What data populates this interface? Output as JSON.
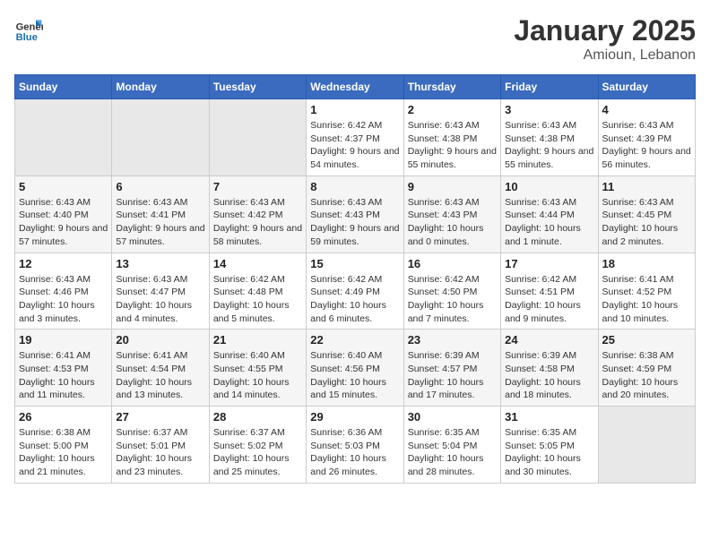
{
  "header": {
    "logo_general": "General",
    "logo_blue": "Blue",
    "month": "January 2025",
    "location": "Amioun, Lebanon"
  },
  "weekdays": [
    "Sunday",
    "Monday",
    "Tuesday",
    "Wednesday",
    "Thursday",
    "Friday",
    "Saturday"
  ],
  "weeks": [
    [
      {
        "day": "",
        "info": ""
      },
      {
        "day": "",
        "info": ""
      },
      {
        "day": "",
        "info": ""
      },
      {
        "day": "1",
        "info": "Sunrise: 6:42 AM\nSunset: 4:37 PM\nDaylight: 9 hours and 54 minutes."
      },
      {
        "day": "2",
        "info": "Sunrise: 6:43 AM\nSunset: 4:38 PM\nDaylight: 9 hours and 55 minutes."
      },
      {
        "day": "3",
        "info": "Sunrise: 6:43 AM\nSunset: 4:38 PM\nDaylight: 9 hours and 55 minutes."
      },
      {
        "day": "4",
        "info": "Sunrise: 6:43 AM\nSunset: 4:39 PM\nDaylight: 9 hours and 56 minutes."
      }
    ],
    [
      {
        "day": "5",
        "info": "Sunrise: 6:43 AM\nSunset: 4:40 PM\nDaylight: 9 hours and 57 minutes."
      },
      {
        "day": "6",
        "info": "Sunrise: 6:43 AM\nSunset: 4:41 PM\nDaylight: 9 hours and 57 minutes."
      },
      {
        "day": "7",
        "info": "Sunrise: 6:43 AM\nSunset: 4:42 PM\nDaylight: 9 hours and 58 minutes."
      },
      {
        "day": "8",
        "info": "Sunrise: 6:43 AM\nSunset: 4:43 PM\nDaylight: 9 hours and 59 minutes."
      },
      {
        "day": "9",
        "info": "Sunrise: 6:43 AM\nSunset: 4:43 PM\nDaylight: 10 hours and 0 minutes."
      },
      {
        "day": "10",
        "info": "Sunrise: 6:43 AM\nSunset: 4:44 PM\nDaylight: 10 hours and 1 minute."
      },
      {
        "day": "11",
        "info": "Sunrise: 6:43 AM\nSunset: 4:45 PM\nDaylight: 10 hours and 2 minutes."
      }
    ],
    [
      {
        "day": "12",
        "info": "Sunrise: 6:43 AM\nSunset: 4:46 PM\nDaylight: 10 hours and 3 minutes."
      },
      {
        "day": "13",
        "info": "Sunrise: 6:43 AM\nSunset: 4:47 PM\nDaylight: 10 hours and 4 minutes."
      },
      {
        "day": "14",
        "info": "Sunrise: 6:42 AM\nSunset: 4:48 PM\nDaylight: 10 hours and 5 minutes."
      },
      {
        "day": "15",
        "info": "Sunrise: 6:42 AM\nSunset: 4:49 PM\nDaylight: 10 hours and 6 minutes."
      },
      {
        "day": "16",
        "info": "Sunrise: 6:42 AM\nSunset: 4:50 PM\nDaylight: 10 hours and 7 minutes."
      },
      {
        "day": "17",
        "info": "Sunrise: 6:42 AM\nSunset: 4:51 PM\nDaylight: 10 hours and 9 minutes."
      },
      {
        "day": "18",
        "info": "Sunrise: 6:41 AM\nSunset: 4:52 PM\nDaylight: 10 hours and 10 minutes."
      }
    ],
    [
      {
        "day": "19",
        "info": "Sunrise: 6:41 AM\nSunset: 4:53 PM\nDaylight: 10 hours and 11 minutes."
      },
      {
        "day": "20",
        "info": "Sunrise: 6:41 AM\nSunset: 4:54 PM\nDaylight: 10 hours and 13 minutes."
      },
      {
        "day": "21",
        "info": "Sunrise: 6:40 AM\nSunset: 4:55 PM\nDaylight: 10 hours and 14 minutes."
      },
      {
        "day": "22",
        "info": "Sunrise: 6:40 AM\nSunset: 4:56 PM\nDaylight: 10 hours and 15 minutes."
      },
      {
        "day": "23",
        "info": "Sunrise: 6:39 AM\nSunset: 4:57 PM\nDaylight: 10 hours and 17 minutes."
      },
      {
        "day": "24",
        "info": "Sunrise: 6:39 AM\nSunset: 4:58 PM\nDaylight: 10 hours and 18 minutes."
      },
      {
        "day": "25",
        "info": "Sunrise: 6:38 AM\nSunset: 4:59 PM\nDaylight: 10 hours and 20 minutes."
      }
    ],
    [
      {
        "day": "26",
        "info": "Sunrise: 6:38 AM\nSunset: 5:00 PM\nDaylight: 10 hours and 21 minutes."
      },
      {
        "day": "27",
        "info": "Sunrise: 6:37 AM\nSunset: 5:01 PM\nDaylight: 10 hours and 23 minutes."
      },
      {
        "day": "28",
        "info": "Sunrise: 6:37 AM\nSunset: 5:02 PM\nDaylight: 10 hours and 25 minutes."
      },
      {
        "day": "29",
        "info": "Sunrise: 6:36 AM\nSunset: 5:03 PM\nDaylight: 10 hours and 26 minutes."
      },
      {
        "day": "30",
        "info": "Sunrise: 6:35 AM\nSunset: 5:04 PM\nDaylight: 10 hours and 28 minutes."
      },
      {
        "day": "31",
        "info": "Sunrise: 6:35 AM\nSunset: 5:05 PM\nDaylight: 10 hours and 30 minutes."
      },
      {
        "day": "",
        "info": ""
      }
    ]
  ]
}
